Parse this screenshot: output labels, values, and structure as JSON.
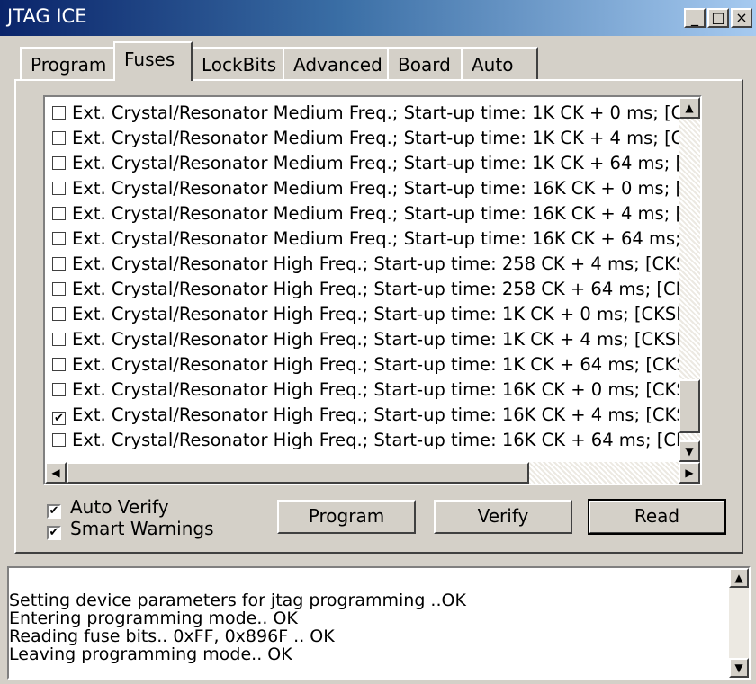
{
  "window": {
    "title": "JTAG ICE",
    "controls": {
      "minimize": "_",
      "maximize": "□",
      "close": "×"
    }
  },
  "tabs": [
    {
      "label": "Program",
      "active": false
    },
    {
      "label": "Fuses",
      "active": true
    },
    {
      "label": "LockBits",
      "active": false
    },
    {
      "label": "Advanced",
      "active": false
    },
    {
      "label": "Board",
      "active": false
    },
    {
      "label": "Auto",
      "active": false
    }
  ],
  "fuse_list": {
    "items": [
      {
        "label": "Ext. Crystal/Resonator Medium Freq.; Start-up time: 1K CK + 0 ms; [C",
        "checked": false
      },
      {
        "label": "Ext. Crystal/Resonator Medium Freq.; Start-up time: 1K CK + 4 ms; [C",
        "checked": false
      },
      {
        "label": "Ext. Crystal/Resonator Medium Freq.; Start-up time: 1K CK + 64 ms; [",
        "checked": false
      },
      {
        "label": "Ext. Crystal/Resonator Medium Freq.; Start-up time: 16K CK + 0 ms; [",
        "checked": false
      },
      {
        "label": "Ext. Crystal/Resonator Medium Freq.; Start-up time: 16K CK + 4 ms; [",
        "checked": false
      },
      {
        "label": "Ext. Crystal/Resonator Medium Freq.; Start-up time: 16K CK + 64 ms;",
        "checked": false
      },
      {
        "label": "Ext. Crystal/Resonator High Freq.; Start-up time: 258 CK + 4 ms; [CKS",
        "checked": false
      },
      {
        "label": "Ext. Crystal/Resonator High Freq.; Start-up time: 258 CK + 64 ms; [CK",
        "checked": false
      },
      {
        "label": "Ext. Crystal/Resonator High Freq.; Start-up time: 1K CK + 0 ms; [CKSE",
        "checked": false
      },
      {
        "label": "Ext. Crystal/Resonator High Freq.; Start-up time: 1K CK + 4 ms; [CKSE",
        "checked": false
      },
      {
        "label": "Ext. Crystal/Resonator High Freq.; Start-up time: 1K CK + 64 ms; [CKS",
        "checked": false
      },
      {
        "label": "Ext. Crystal/Resonator High Freq.; Start-up time: 16K CK + 0 ms; [CKS",
        "checked": false
      },
      {
        "label": "Ext. Crystal/Resonator High Freq.; Start-up time: 16K CK + 4 ms; [CKS",
        "checked": true
      },
      {
        "label": "Ext. Crystal/Resonator High Freq.; Start-up time: 16K CK + 64 ms; [CK",
        "checked": false
      }
    ]
  },
  "options": {
    "auto_verify": {
      "label": "Auto Verify",
      "checked": true
    },
    "smart_warnings": {
      "label": "Smart Warnings",
      "checked": true
    }
  },
  "buttons": {
    "program": "Program",
    "verify": "Verify",
    "read": "Read"
  },
  "log": {
    "lines": [
      "Setting device parameters for jtag programming ..OK",
      "Entering programming mode.. OK",
      "Reading fuse bits.. 0xFF, 0x896F .. OK",
      "Leaving programming mode.. OK"
    ]
  }
}
